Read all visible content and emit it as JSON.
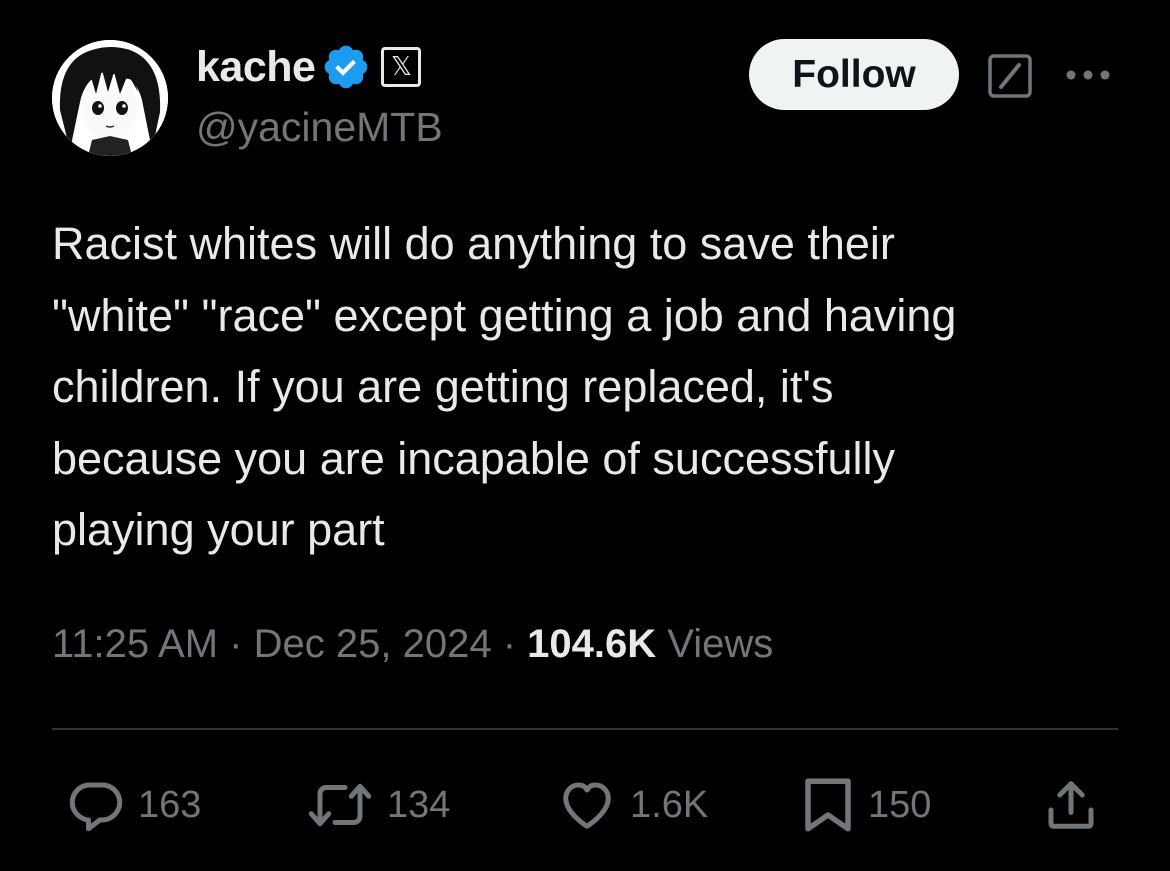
{
  "author": {
    "display_name": "kache",
    "handle": "@yacineMTB",
    "verified": true,
    "affiliate_badge": "𝕏",
    "avatar_icon": "anime-avatar"
  },
  "header": {
    "follow_label": "Follow",
    "grok_icon": "grok-icon",
    "more_icon": "more-horizontal-icon"
  },
  "tweet": {
    "text": "Racist whites will do anything to save their\n\"white\" \"race\" except getting a job and having\nchildren. If you are getting replaced, it's\nbecause you are incapable of successfully\nplaying your part"
  },
  "meta": {
    "time": "11:25 AM",
    "separator": "·",
    "date": "Dec 25, 2024",
    "views_count": "104.6K",
    "views_label": "Views"
  },
  "actions": {
    "replies": "163",
    "reposts": "134",
    "likes": "1.6K",
    "bookmarks": "150"
  },
  "colors": {
    "background": "#000000",
    "text_primary": "#e7e9ea",
    "text_secondary": "#71767b",
    "verified_blue": "#1d9bf0",
    "divider": "#2f3336",
    "follow_bg": "#eff3f4"
  }
}
